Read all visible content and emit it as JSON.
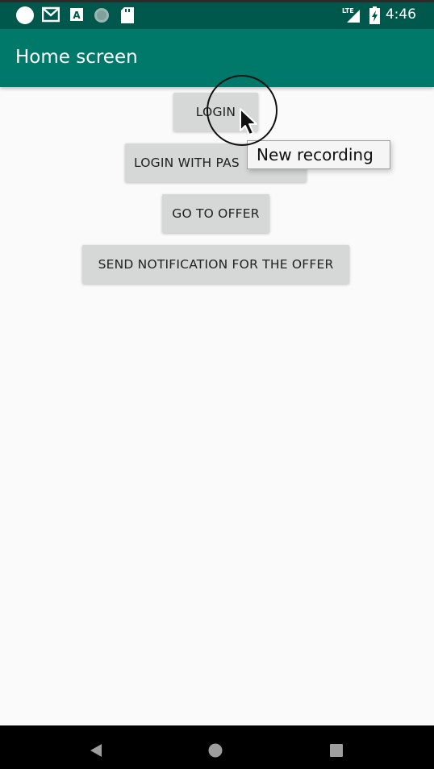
{
  "status_bar": {
    "time": "4:46",
    "icons": [
      "circle-icon",
      "gmail-icon",
      "font-a-icon",
      "globe-icon",
      "sd-card-icon",
      "lte-signal-icon",
      "battery-charging-icon"
    ],
    "background": "#00574b"
  },
  "app_bar": {
    "title": "Home screen",
    "background": "#00796b"
  },
  "buttons": {
    "login": "LOGIN",
    "login_with_password": "LOGIN WITH PAS",
    "go_to_offer": "GO TO OFFER",
    "send_notification": "SEND NOTIFICATION FOR THE OFFER"
  },
  "tooltip": {
    "text": "New recording"
  },
  "nav_bar": {
    "icons": [
      "back-icon",
      "home-icon",
      "recents-icon"
    ]
  }
}
